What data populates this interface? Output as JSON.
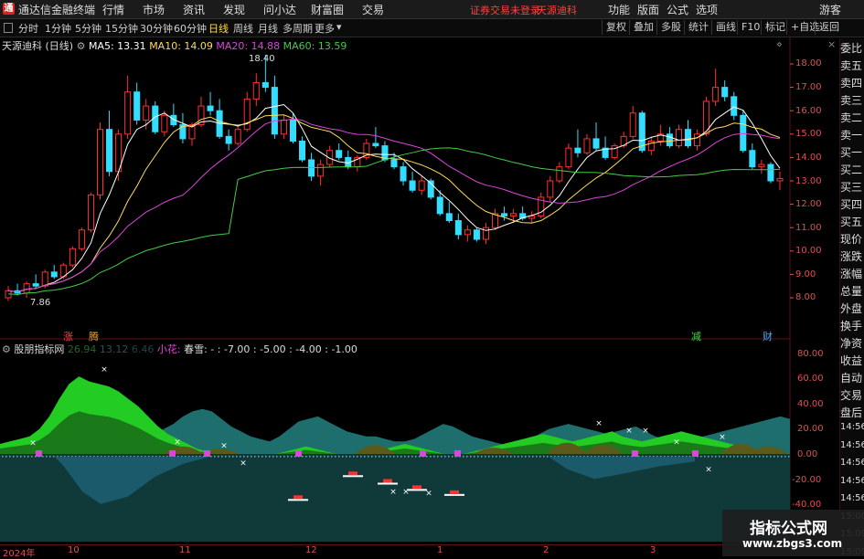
{
  "app": {
    "title": "通达信金融终端",
    "logo_text": "通",
    "warning": "证券交易未登录",
    "stock_name_top": "天源迪科",
    "menus": [
      "行情",
      "市场",
      "资讯",
      "发现",
      "问小达",
      "财富圈",
      "交易"
    ],
    "right_menus": [
      "功能",
      "版面",
      "公式",
      "选项",
      "游客"
    ]
  },
  "toolbar": {
    "periods": [
      "分时",
      "1分钟",
      "5分钟",
      "15分钟",
      "30分钟",
      "60分钟",
      "日线",
      "周线",
      "月线",
      "多周期",
      "更多"
    ],
    "active_period": "日线",
    "buttons": [
      "复权",
      "叠加",
      "多股",
      "统计",
      "画线",
      "F10",
      "标记",
      "+自选",
      "返回"
    ]
  },
  "main_legend": {
    "name": "天源迪科",
    "period": "(日线)",
    "ma5": "MA5: 13.31",
    "ma10": "MA10: 14.09",
    "ma20": "MA20: 14.88",
    "ma60": "MA60: 13.59"
  },
  "price_axis": [
    "18.00",
    "17.00",
    "16.00",
    "15.00",
    "14.00",
    "13.00",
    "12.00",
    "11.00",
    "10.00",
    "9.00",
    "8.00"
  ],
  "annotations": {
    "high": "18.40",
    "low": "7.86",
    "zhang": "涨",
    "teng": "腾",
    "jian": "减",
    "cai": "财"
  },
  "indicator_legend": {
    "name": "股朋指标网",
    "v1": "26.94",
    "v2": "13.12",
    "v3": "6.46",
    "xiaohua": "小花:",
    "chunxue": "春雪: -",
    "params": ": -7.00 : -5.00 : -4.00 : -1.00"
  },
  "indicator_axis": [
    "80.00",
    "60.00",
    "40.00",
    "20.00",
    "0.00",
    "-20.00",
    "-40.00"
  ],
  "date_axis": [
    "2024年",
    "10",
    "11",
    "12",
    "1",
    "2",
    "3"
  ],
  "right_panel": [
    "委比",
    "卖五",
    "卖四",
    "卖三",
    "卖二",
    "卖一",
    "买一",
    "买二",
    "买三",
    "买四",
    "买五",
    "现价",
    "涨跌",
    "涨幅",
    "总量",
    "外盘",
    "换手",
    "净资",
    "收益",
    "自动",
    "交易",
    "盘后",
    "14:56",
    "14:56",
    "14:56",
    "14:56",
    "14:56",
    "15:00",
    "15:09",
    "15:09"
  ],
  "watermark": {
    "line1": "指标公式网",
    "line2": "www.zbgs3.com"
  },
  "colors": {
    "up": "#ff3030",
    "down": "#33ddff",
    "ma5": "#ffffff",
    "ma10": "#ffdd55",
    "ma20": "#dd44dd",
    "ma60": "#44cc44",
    "axis": "#e05050"
  },
  "chart_data": {
    "type": "candlestick",
    "x_range": [
      "2024-09",
      "2025-03"
    ],
    "y_range": [
      7.5,
      18.5
    ],
    "candles": [
      {
        "o": 8.0,
        "h": 8.5,
        "l": 7.86,
        "c": 8.3
      },
      {
        "o": 8.3,
        "h": 8.6,
        "l": 8.1,
        "c": 8.2
      },
      {
        "o": 8.2,
        "h": 8.7,
        "l": 8.0,
        "c": 8.6
      },
      {
        "o": 8.6,
        "h": 9.0,
        "l": 8.4,
        "c": 8.5
      },
      {
        "o": 8.5,
        "h": 9.2,
        "l": 8.4,
        "c": 9.1
      },
      {
        "o": 9.1,
        "h": 9.4,
        "l": 8.8,
        "c": 8.9
      },
      {
        "o": 8.9,
        "h": 9.5,
        "l": 8.8,
        "c": 9.4
      },
      {
        "o": 9.4,
        "h": 10.2,
        "l": 9.3,
        "c": 10.1
      },
      {
        "o": 10.1,
        "h": 11.0,
        "l": 10.0,
        "c": 10.9
      },
      {
        "o": 10.9,
        "h": 12.5,
        "l": 10.8,
        "c": 12.4
      },
      {
        "o": 12.4,
        "h": 15.5,
        "l": 12.2,
        "c": 15.2
      },
      {
        "o": 15.2,
        "h": 16.0,
        "l": 13.2,
        "c": 13.4
      },
      {
        "o": 13.4,
        "h": 15.2,
        "l": 13.0,
        "c": 15.0
      },
      {
        "o": 15.0,
        "h": 17.5,
        "l": 14.8,
        "c": 16.8
      },
      {
        "o": 16.8,
        "h": 17.2,
        "l": 15.4,
        "c": 15.6
      },
      {
        "o": 15.6,
        "h": 16.5,
        "l": 15.2,
        "c": 16.2
      },
      {
        "o": 16.2,
        "h": 16.4,
        "l": 15.0,
        "c": 15.1
      },
      {
        "o": 15.1,
        "h": 16.0,
        "l": 14.9,
        "c": 15.8
      },
      {
        "o": 15.8,
        "h": 16.3,
        "l": 15.3,
        "c": 15.4
      },
      {
        "o": 15.4,
        "h": 15.9,
        "l": 14.6,
        "c": 14.8
      },
      {
        "o": 14.8,
        "h": 15.5,
        "l": 14.5,
        "c": 15.4
      },
      {
        "o": 15.4,
        "h": 16.6,
        "l": 15.3,
        "c": 16.2
      },
      {
        "o": 16.2,
        "h": 16.8,
        "l": 15.8,
        "c": 16.0
      },
      {
        "o": 16.0,
        "h": 16.5,
        "l": 14.8,
        "c": 14.9
      },
      {
        "o": 14.9,
        "h": 15.2,
        "l": 14.3,
        "c": 14.6
      },
      {
        "o": 14.6,
        "h": 15.4,
        "l": 14.5,
        "c": 15.2
      },
      {
        "o": 15.2,
        "h": 16.8,
        "l": 15.1,
        "c": 16.5
      },
      {
        "o": 16.5,
        "h": 17.6,
        "l": 16.2,
        "c": 17.2
      },
      {
        "o": 17.2,
        "h": 18.4,
        "l": 16.8,
        "c": 17.0
      },
      {
        "o": 17.0,
        "h": 17.5,
        "l": 14.8,
        "c": 15.0
      },
      {
        "o": 15.0,
        "h": 15.8,
        "l": 14.8,
        "c": 15.6
      },
      {
        "o": 15.6,
        "h": 15.9,
        "l": 14.6,
        "c": 14.7
      },
      {
        "o": 14.7,
        "h": 14.9,
        "l": 13.8,
        "c": 13.9
      },
      {
        "o": 13.9,
        "h": 14.2,
        "l": 13.0,
        "c": 13.2
      },
      {
        "o": 13.2,
        "h": 13.9,
        "l": 12.8,
        "c": 13.7
      },
      {
        "o": 13.7,
        "h": 14.5,
        "l": 13.6,
        "c": 14.3
      },
      {
        "o": 14.3,
        "h": 14.6,
        "l": 13.9,
        "c": 14.0
      },
      {
        "o": 14.0,
        "h": 14.3,
        "l": 13.5,
        "c": 13.6
      },
      {
        "o": 13.6,
        "h": 14.1,
        "l": 13.4,
        "c": 14.0
      },
      {
        "o": 14.0,
        "h": 14.8,
        "l": 13.9,
        "c": 14.6
      },
      {
        "o": 14.6,
        "h": 15.3,
        "l": 14.4,
        "c": 14.5
      },
      {
        "o": 14.5,
        "h": 14.7,
        "l": 13.8,
        "c": 13.9
      },
      {
        "o": 13.9,
        "h": 14.2,
        "l": 13.5,
        "c": 13.6
      },
      {
        "o": 13.6,
        "h": 13.8,
        "l": 12.8,
        "c": 13.0
      },
      {
        "o": 13.0,
        "h": 13.4,
        "l": 12.5,
        "c": 12.6
      },
      {
        "o": 12.6,
        "h": 13.2,
        "l": 12.4,
        "c": 13.0
      },
      {
        "o": 13.0,
        "h": 13.1,
        "l": 12.2,
        "c": 12.3
      },
      {
        "o": 12.3,
        "h": 12.6,
        "l": 11.5,
        "c": 11.6
      },
      {
        "o": 11.6,
        "h": 12.1,
        "l": 11.2,
        "c": 11.3
      },
      {
        "o": 11.3,
        "h": 11.6,
        "l": 10.5,
        "c": 10.7
      },
      {
        "o": 10.7,
        "h": 11.1,
        "l": 10.4,
        "c": 10.9
      },
      {
        "o": 10.9,
        "h": 11.0,
        "l": 10.4,
        "c": 10.5
      },
      {
        "o": 10.5,
        "h": 11.2,
        "l": 10.3,
        "c": 11.0
      },
      {
        "o": 11.0,
        "h": 11.8,
        "l": 10.9,
        "c": 11.6
      },
      {
        "o": 11.6,
        "h": 11.9,
        "l": 11.3,
        "c": 11.5
      },
      {
        "o": 11.5,
        "h": 11.8,
        "l": 11.2,
        "c": 11.6
      },
      {
        "o": 11.6,
        "h": 11.9,
        "l": 11.3,
        "c": 11.4
      },
      {
        "o": 11.4,
        "h": 11.7,
        "l": 11.2,
        "c": 11.5
      },
      {
        "o": 11.5,
        "h": 12.5,
        "l": 11.4,
        "c": 12.3
      },
      {
        "o": 12.3,
        "h": 13.2,
        "l": 12.1,
        "c": 13.0
      },
      {
        "o": 13.0,
        "h": 13.8,
        "l": 12.9,
        "c": 13.6
      },
      {
        "o": 13.6,
        "h": 14.6,
        "l": 13.5,
        "c": 14.4
      },
      {
        "o": 14.4,
        "h": 15.2,
        "l": 14.0,
        "c": 14.2
      },
      {
        "o": 14.2,
        "h": 15.0,
        "l": 14.1,
        "c": 14.8
      },
      {
        "o": 14.8,
        "h": 15.5,
        "l": 14.3,
        "c": 14.4
      },
      {
        "o": 14.4,
        "h": 14.9,
        "l": 13.9,
        "c": 14.0
      },
      {
        "o": 14.0,
        "h": 14.6,
        "l": 13.9,
        "c": 14.5
      },
      {
        "o": 14.5,
        "h": 15.1,
        "l": 14.4,
        "c": 14.9
      },
      {
        "o": 14.9,
        "h": 16.2,
        "l": 14.8,
        "c": 15.9
      },
      {
        "o": 15.9,
        "h": 16.0,
        "l": 14.2,
        "c": 14.3
      },
      {
        "o": 14.3,
        "h": 14.9,
        "l": 14.1,
        "c": 14.7
      },
      {
        "o": 14.7,
        "h": 15.4,
        "l": 14.5,
        "c": 15.0
      },
      {
        "o": 15.0,
        "h": 15.3,
        "l": 14.4,
        "c": 14.5
      },
      {
        "o": 14.5,
        "h": 15.4,
        "l": 14.4,
        "c": 15.2
      },
      {
        "o": 15.2,
        "h": 15.6,
        "l": 14.4,
        "c": 14.5
      },
      {
        "o": 14.5,
        "h": 15.2,
        "l": 14.3,
        "c": 15.0
      },
      {
        "o": 15.0,
        "h": 16.6,
        "l": 14.9,
        "c": 16.4
      },
      {
        "o": 16.4,
        "h": 17.8,
        "l": 16.2,
        "c": 17.0
      },
      {
        "o": 17.0,
        "h": 17.3,
        "l": 16.4,
        "c": 16.6
      },
      {
        "o": 16.6,
        "h": 16.8,
        "l": 15.6,
        "c": 15.8
      },
      {
        "o": 15.8,
        "h": 16.0,
        "l": 14.2,
        "c": 14.3
      },
      {
        "o": 14.3,
        "h": 14.6,
        "l": 13.5,
        "c": 13.6
      },
      {
        "o": 13.6,
        "h": 13.9,
        "l": 13.3,
        "c": 13.7
      },
      {
        "o": 13.7,
        "h": 13.8,
        "l": 12.9,
        "c": 13.0
      },
      {
        "o": 13.0,
        "h": 13.4,
        "l": 12.6,
        "c": 13.1
      }
    ]
  }
}
